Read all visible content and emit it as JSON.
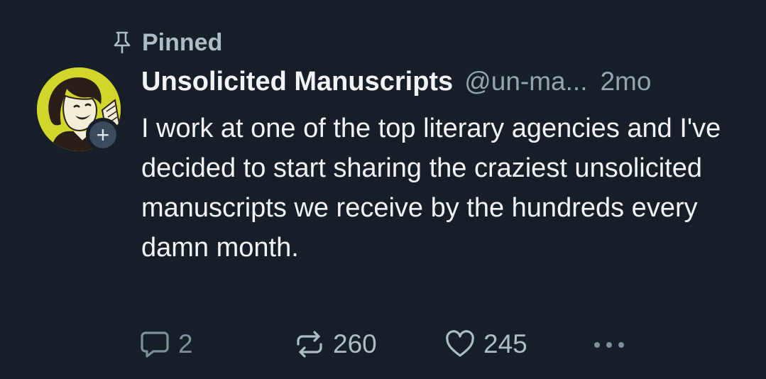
{
  "pinned": {
    "label": "Pinned"
  },
  "author": {
    "display_name": "Unsolicited Manuscripts",
    "handle": "@un-ma...",
    "time": "2mo",
    "avatar": "vintage-woman-reading-illustration",
    "follow_badge": "+"
  },
  "post": {
    "text": "I work at one of the top literary agencies and I've decided to start sharing the craziest unsolicited manuscripts we receive by the hundreds every damn month."
  },
  "actions": {
    "replies": "2",
    "reposts": "260",
    "likes": "245"
  },
  "icons": {
    "pin": "pin-icon",
    "reply": "speech-bubble-icon",
    "repost": "repost-arrows-icon",
    "like": "heart-icon",
    "more": "ellipsis-icon"
  },
  "colors": {
    "background": "#161e27",
    "primary_text": "#f1f3f5",
    "secondary_text": "#95a3b3",
    "avatar_bg": "#d2d52a"
  }
}
